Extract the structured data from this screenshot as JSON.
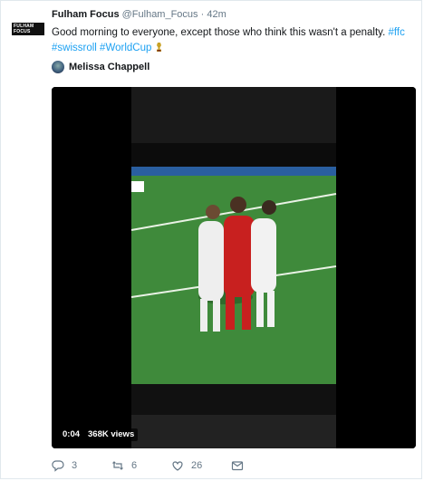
{
  "tweet": {
    "avatar_text": "FULHAM FOCUS",
    "author_name": "Fulham Focus",
    "author_handle": "@Fulham_Focus",
    "separator": "·",
    "time": "42m",
    "text_plain": "Good morning to everyone, except those who think this wasn't a penalty.",
    "hashtags": [
      "#ffc",
      "#swissroll",
      "#WorldCup"
    ],
    "mentioned_user": "Melissa Chappell",
    "video": {
      "duration": "0:04",
      "views": "368K views"
    },
    "actions": {
      "replies": "3",
      "retweets": "6",
      "likes": "26"
    },
    "colors": {
      "link": "#1da1f2",
      "muted": "#657786",
      "text": "#14171a"
    }
  }
}
